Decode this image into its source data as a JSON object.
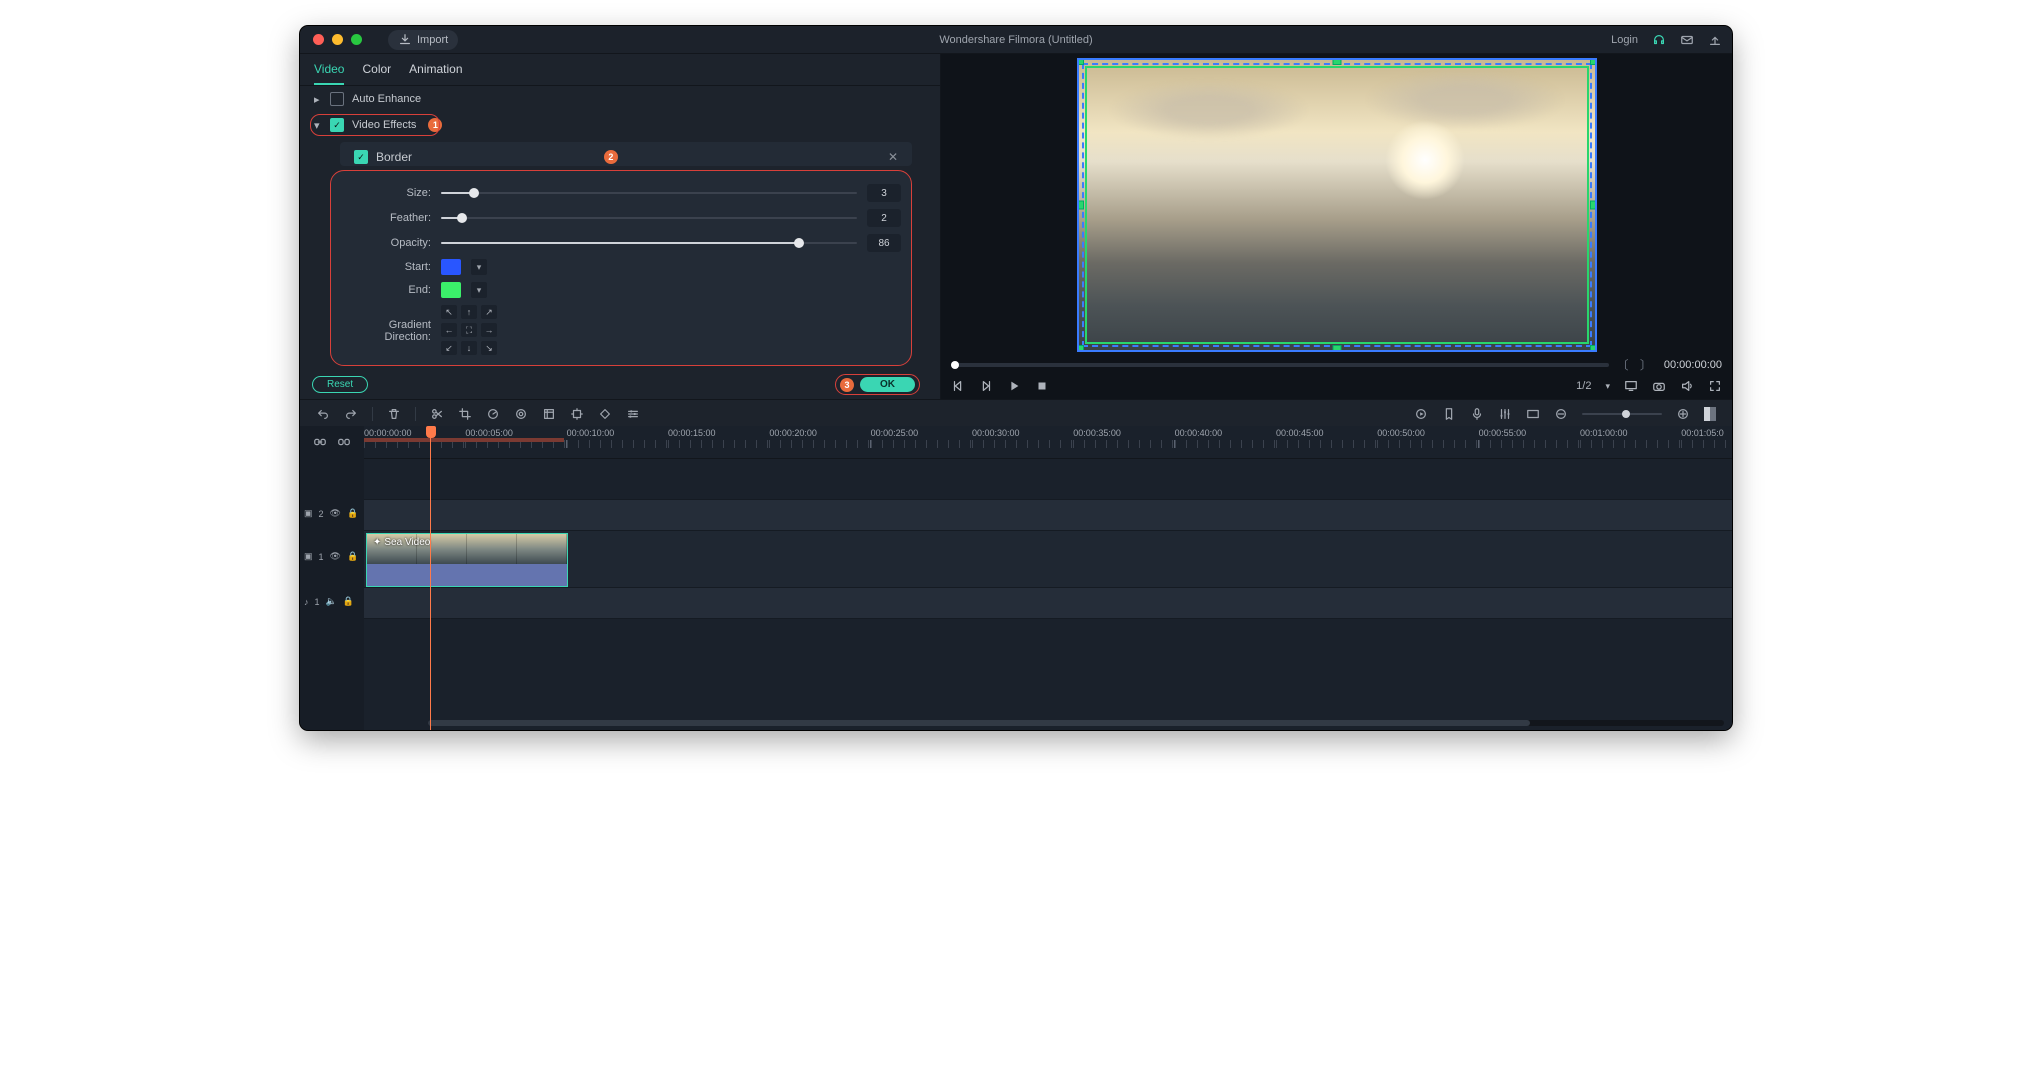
{
  "app": {
    "title": "Wondershare Filmora (Untitled)",
    "import_label": "Import",
    "login_label": "Login"
  },
  "tabs": {
    "video": "Video",
    "color": "Color",
    "animation": "Animation"
  },
  "sections": {
    "auto_enhance": "Auto Enhance",
    "video_effects": "Video Effects",
    "border": "Border"
  },
  "badges": {
    "one": "1",
    "two": "2",
    "three": "3"
  },
  "props": {
    "size": {
      "label": "Size:",
      "value": "3",
      "pct": 8
    },
    "feather": {
      "label": "Feather:",
      "value": "2",
      "pct": 5
    },
    "opacity": {
      "label": "Opacity:",
      "value": "86",
      "pct": 86
    },
    "start": {
      "label": "Start:",
      "color": "#2956ff"
    },
    "end": {
      "label": "End:",
      "color": "#3bf06a"
    },
    "grad_label": "Gradient Direction:"
  },
  "buttons": {
    "reset": "Reset",
    "ok": "OK"
  },
  "preview": {
    "timecode": "00:00:00:00",
    "zoom": "1/2"
  },
  "ruler": [
    "00:00:00:00",
    "00:00:05:00",
    "00:00:10:00",
    "00:00:15:00",
    "00:00:20:00",
    "00:00:25:00",
    "00:00:30:00",
    "00:00:35:00",
    "00:00:40:00",
    "00:00:45:00",
    "00:00:50:00",
    "00:00:55:00",
    "00:01:00:00",
    "00:01:05:0"
  ],
  "clip": {
    "name": "Sea Video"
  },
  "tracks": {
    "v2": "2",
    "v1": "1",
    "a1": "1"
  }
}
